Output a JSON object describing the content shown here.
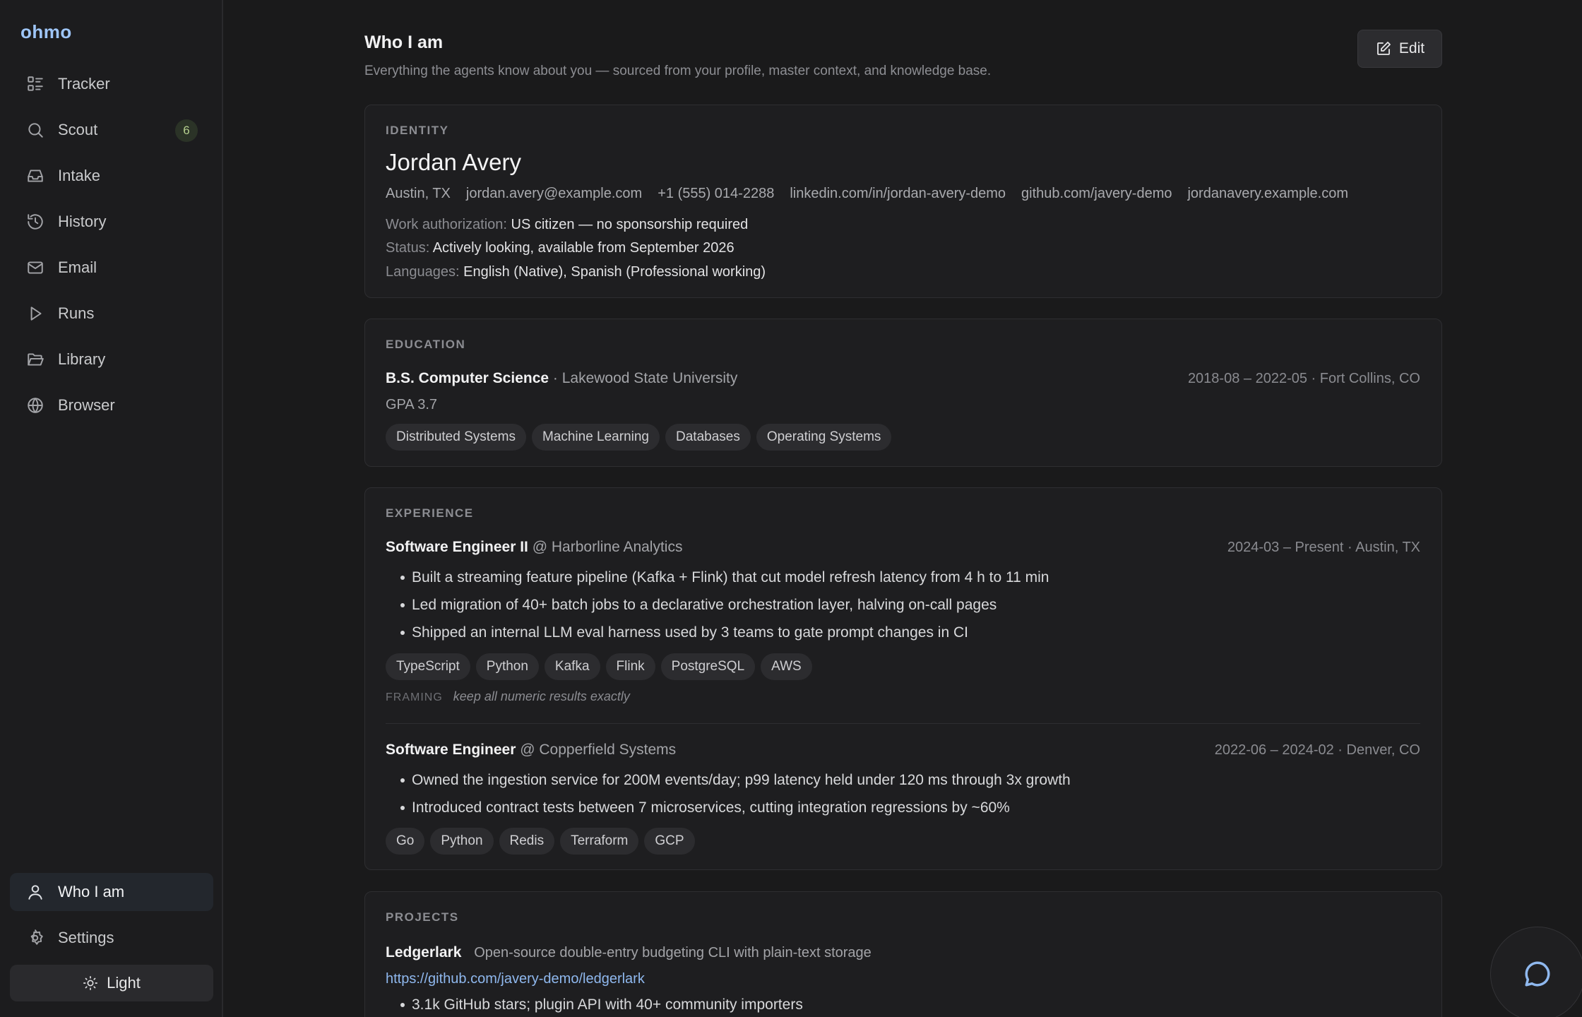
{
  "app": {
    "brand": "ohmo"
  },
  "sidebar": {
    "items": [
      {
        "label": "Tracker",
        "icon": "tracker-icon"
      },
      {
        "label": "Scout",
        "icon": "search-icon",
        "badge": "6"
      },
      {
        "label": "Intake",
        "icon": "inbox-icon"
      },
      {
        "label": "History",
        "icon": "history-icon"
      },
      {
        "label": "Email",
        "icon": "mail-icon"
      },
      {
        "label": "Runs",
        "icon": "play-icon"
      },
      {
        "label": "Library",
        "icon": "folder-icon"
      },
      {
        "label": "Browser",
        "icon": "globe-icon"
      }
    ],
    "bottom": [
      {
        "label": "Who I am",
        "icon": "user-icon",
        "active": true
      },
      {
        "label": "Settings",
        "icon": "gear-icon"
      }
    ],
    "theme_toggle": "Light"
  },
  "header": {
    "title": "Who I am",
    "subtitle": "Everything the agents know about you — sourced from your profile, master context, and knowledge base.",
    "edit_label": "Edit"
  },
  "identity": {
    "section": "IDENTITY",
    "name": "Jordan Avery",
    "contacts": [
      "Austin, TX",
      "jordan.avery@example.com",
      "+1 (555) 014-2288",
      "linkedin.com/in/jordan-avery-demo",
      "github.com/javery-demo",
      "jordanavery.example.com"
    ],
    "fields": [
      {
        "key": "Work authorization:",
        "value": "US citizen — no sponsorship required"
      },
      {
        "key": "Status:",
        "value": "Actively looking, available from September 2026"
      },
      {
        "key": "Languages:",
        "value": "English (Native), Spanish (Professional working)"
      }
    ]
  },
  "education": {
    "section": "EDUCATION",
    "degree": "B.S. Computer Science",
    "school": "· Lakewood State University",
    "meta": "2018-08 – 2022-05 · Fort Collins, CO",
    "gpa": "GPA 3.7",
    "courses": [
      "Distributed Systems",
      "Machine Learning",
      "Databases",
      "Operating Systems"
    ]
  },
  "experience": {
    "section": "EXPERIENCE",
    "jobs": [
      {
        "title": "Software Engineer II",
        "org": "@ Harborline Analytics",
        "meta": "2024-03 – Present · Austin, TX",
        "bullets": [
          "Built a streaming feature pipeline (Kafka + Flink) that cut model refresh latency from 4 h to 11 min",
          "Led migration of 40+ batch jobs to a declarative orchestration layer, halving on-call pages",
          "Shipped an internal LLM eval harness used by 3 teams to gate prompt changes in CI"
        ],
        "skills": [
          "TypeScript",
          "Python",
          "Kafka",
          "Flink",
          "PostgreSQL",
          "AWS"
        ],
        "framing_label": "FRAMING",
        "framing": "keep all numeric results exactly"
      },
      {
        "title": "Software Engineer",
        "org": "@ Copperfield Systems",
        "meta": "2022-06 – 2024-02 · Denver, CO",
        "bullets": [
          "Owned the ingestion service for 200M events/day; p99 latency held under 120 ms through 3x growth",
          "Introduced contract tests between 7 microservices, cutting integration regressions by ~60%"
        ],
        "skills": [
          "Go",
          "Python",
          "Redis",
          "Terraform",
          "GCP"
        ]
      }
    ]
  },
  "projects": {
    "section": "PROJECTS",
    "items": [
      {
        "name": "Ledgerlark",
        "desc": "Open-source double-entry budgeting CLI with plain-text storage",
        "url": "https://github.com/javery-demo/ledgerlark",
        "bullets": [
          "3.1k GitHub stars; plugin API with 40+ community importers"
        ]
      }
    ]
  },
  "colors": {
    "accent": "#9ec5f7",
    "link": "#8fb8ee",
    "badge_text": "#b5cf8e"
  }
}
